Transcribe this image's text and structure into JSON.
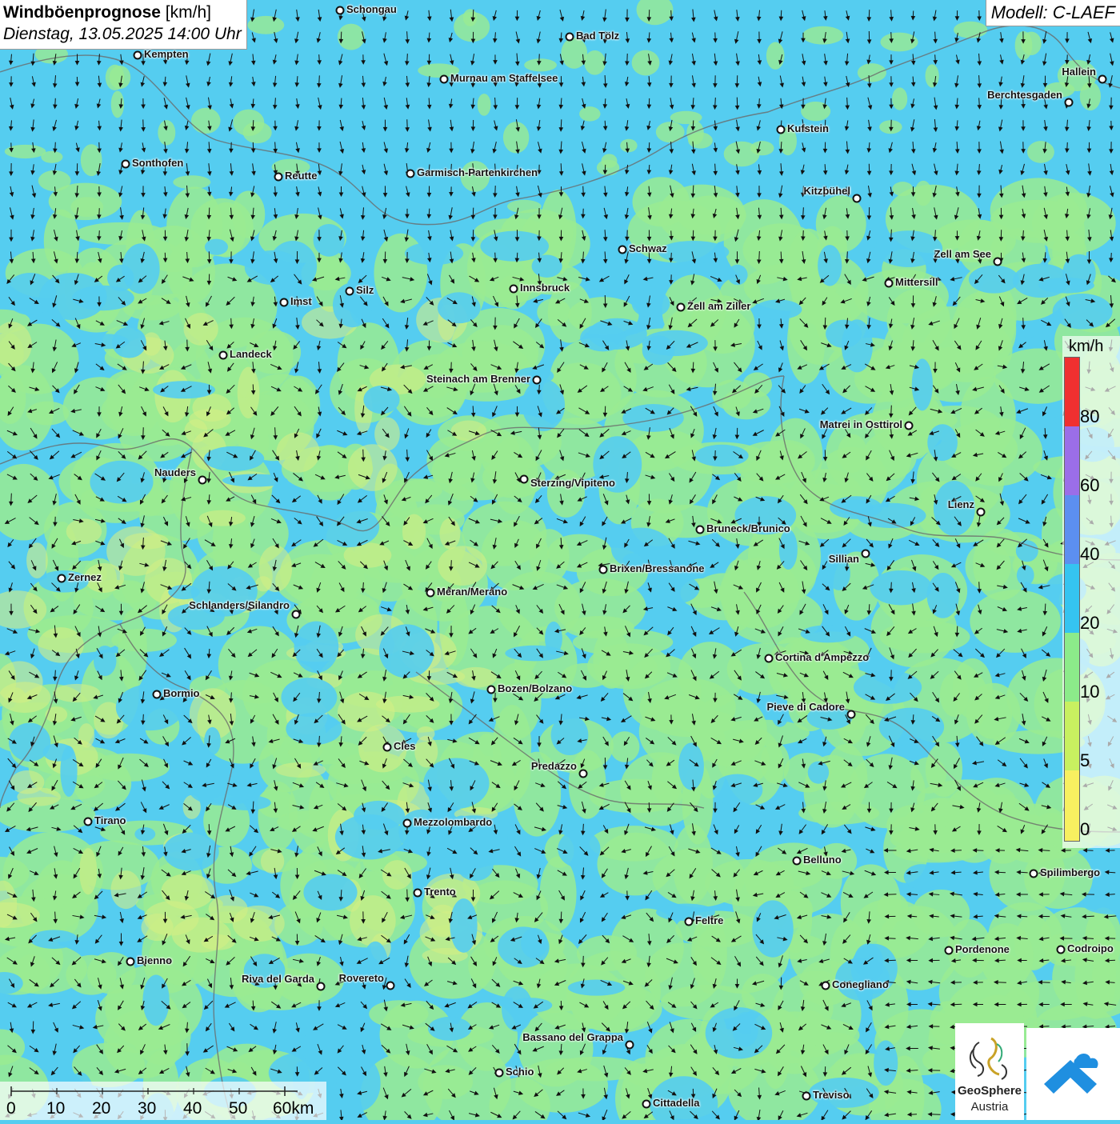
{
  "header": {
    "title_bold": "Windböenprognose",
    "title_unit": " [km/h]",
    "datetime": "Dienstag, 13.05.2025 14:00 Uhr",
    "model": "Modell: C-LAEF"
  },
  "legend": {
    "unit": "km/h",
    "ticks": [
      "80",
      "60",
      "40",
      "20",
      "10",
      "5",
      "0"
    ],
    "colors": [
      "#f03030",
      "#9b6ee8",
      "#5c8ff0",
      "#35c4f0",
      "#8ceb8a",
      "#c8f060",
      "#f8f060"
    ]
  },
  "scale_bar": {
    "labels": [
      "0",
      "10",
      "20",
      "30",
      "40",
      "50",
      "60km"
    ]
  },
  "logos": {
    "geosphere_line1": "GeoSphere",
    "geosphere_line2": "Austria"
  },
  "cities": [
    {
      "name": "Schongau"
    },
    {
      "name": "Bad Tölz"
    },
    {
      "name": "Kempten"
    },
    {
      "name": "Murnau am Staffelsee"
    },
    {
      "name": "Hallein"
    },
    {
      "name": "Berchtesgaden"
    },
    {
      "name": "Kufstein"
    },
    {
      "name": "Sonthofen"
    },
    {
      "name": "Reutte"
    },
    {
      "name": "Garmisch-Partenkirchen"
    },
    {
      "name": "Kitzbühel"
    },
    {
      "name": "Schwaz"
    },
    {
      "name": "Zell am See"
    },
    {
      "name": "Mittersill"
    },
    {
      "name": "Silz"
    },
    {
      "name": "Innsbruck"
    },
    {
      "name": "Imst"
    },
    {
      "name": "Zell am Ziller"
    },
    {
      "name": "Landeck"
    },
    {
      "name": "Steinach am Brenner"
    },
    {
      "name": "Matrei in Osttirol"
    },
    {
      "name": "Nauders"
    },
    {
      "name": "Sterzing/Vipiteno"
    },
    {
      "name": "Lienz"
    },
    {
      "name": "Bruneck/Brunico"
    },
    {
      "name": "Sillian"
    },
    {
      "name": "Brixen/Bressanone"
    },
    {
      "name": "Zernez"
    },
    {
      "name": "Meran/Merano"
    },
    {
      "name": "Schlanders/Silandro"
    },
    {
      "name": "Cortina d'Ampezzo"
    },
    {
      "name": "Bozen/Bolzano"
    },
    {
      "name": "Bormio"
    },
    {
      "name": "Pieve di Cadore"
    },
    {
      "name": "Cles"
    },
    {
      "name": "Predazzo"
    },
    {
      "name": "Tirano"
    },
    {
      "name": "Mezzolombardo"
    },
    {
      "name": "Belluno"
    },
    {
      "name": "Spilimbergo"
    },
    {
      "name": "Trento"
    },
    {
      "name": "Feltre"
    },
    {
      "name": "Pordenone"
    },
    {
      "name": "Codroipo"
    },
    {
      "name": "Bienno"
    },
    {
      "name": "Riva del Garda"
    },
    {
      "name": "Rovereto"
    },
    {
      "name": "Conegliano"
    },
    {
      "name": "Bassano del Grappa"
    },
    {
      "name": "Schio"
    },
    {
      "name": "Treviso"
    },
    {
      "name": "Cittadella"
    }
  ]
}
